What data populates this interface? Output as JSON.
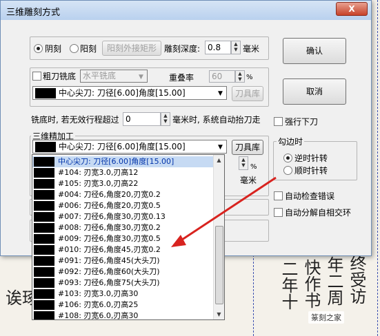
{
  "dialog": {
    "title": "三维雕刻方式",
    "close": "X",
    "mode": {
      "yin": "阴刻",
      "yang": "阳刻",
      "rect": "阳刻外接矩形",
      "depth_label": "雕刻深度:",
      "depth_value": "0.8",
      "depth_unit": "毫米"
    },
    "ok": "确认",
    "cancel": "取消",
    "rough": {
      "label": "粗刀铣底",
      "method": "水平铣底",
      "overlap_label": "重叠率",
      "overlap_value": "60",
      "overlap_unit": "%"
    },
    "rough_tool": {
      "value": "中心尖刀: 刀径[6.00]角度[15.00]",
      "library": "刀具库"
    },
    "lift": {
      "label": "铣底时, 若无效行程超过",
      "value": "0",
      "unit": "毫米时, 系统自动抬刀走"
    },
    "force_down": "强行下刀",
    "finish": {
      "group": "三维精加工",
      "tool": "中心尖刀: 刀径[6.00]角度[15.00]",
      "library": "刀具库"
    },
    "partial": {
      "unit1": "%",
      "unit2": "毫米"
    },
    "direction": {
      "group": "勾边时",
      "ccw": "逆时针转",
      "cw": "顺时针转"
    },
    "auto_check": "自动检查错误",
    "auto_split": "自动分解自相交环"
  },
  "dropdown": [
    "中心尖刀: 刀径[6.00]角度[15.00]",
    "#104: 刃宽3.0,刃高12",
    "#105: 刃宽3.0,刃高22",
    "#004: 刀径6,角度20,刃宽0.2",
    "#006: 刀径6,角度20,刃宽0.5",
    "#007: 刀径6,角度30,刃宽0.13",
    "#008: 刀径6,角度30,刃宽0.2",
    "#009: 刀径6,角度30,刃宽0.5",
    "#010: 刀径6,角度45,刃宽0.2",
    "#091: 刀径6,角度45(大头刀)",
    "#092: 刀径6,角度60(大头刀)",
    "#093: 刀径6,角度75(大头刀)",
    "#103: 刃宽3.0,刃高30",
    "#106: 刃宽6.0,刃高25",
    "#108: 刃宽6.0,刃高30"
  ],
  "watermark": "篆刻之家",
  "background_text": {
    "col1": "二年十",
    "col2": "快作书",
    "col3": "年二周",
    "col4": "终受访",
    "left": "诶琢"
  }
}
